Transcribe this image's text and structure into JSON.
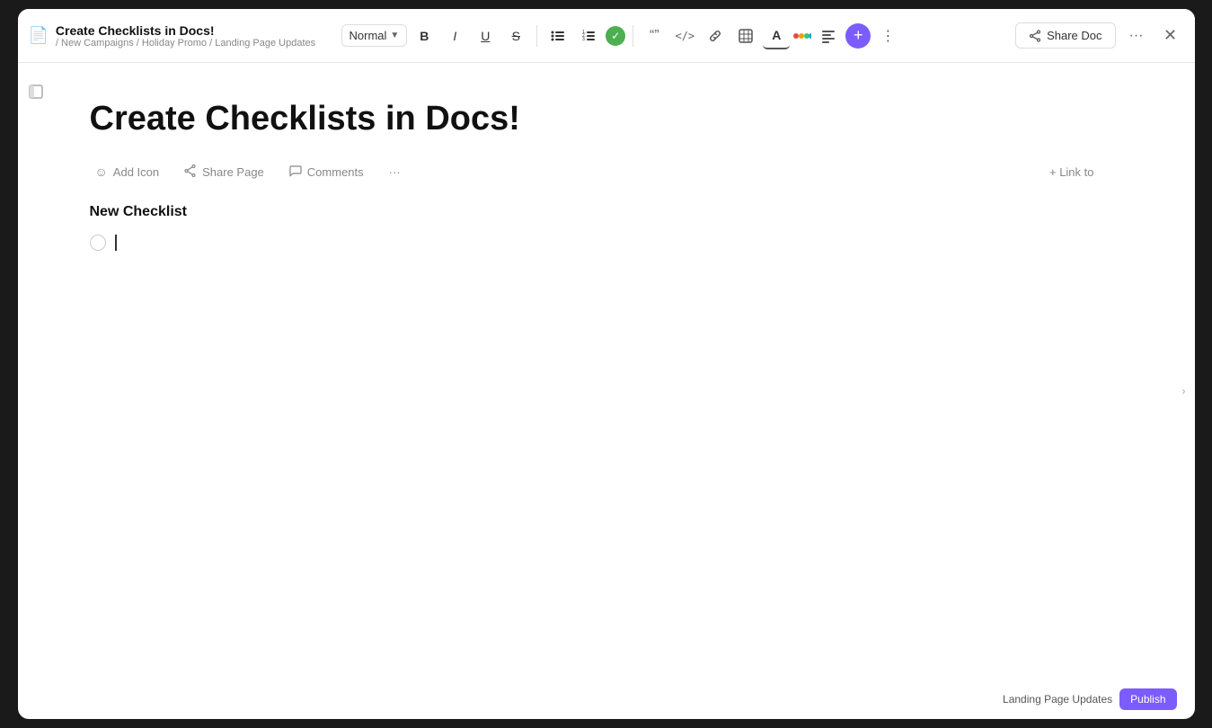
{
  "window": {
    "doc_icon": "📄",
    "title": "Create Checklists in Docs!",
    "breadcrumb": "/ New Campaigns / Holiday Promo / Landing Page Updates"
  },
  "toolbar": {
    "normal_label": "Normal",
    "bold_label": "B",
    "italic_label": "I",
    "underline_label": "U",
    "strikethrough_label": "S",
    "bullet_label": "≡",
    "numbered_label": "≡",
    "quote_label": "❝❞",
    "code_label": "</>",
    "link_label": "🔗",
    "table_label": "⊞",
    "text_color_label": "A",
    "align_label": "≡",
    "share_doc_label": "Share Doc",
    "more_label": "···",
    "close_label": "✕"
  },
  "doc": {
    "heading": "Create Checklists in Docs!",
    "add_icon_label": "Add Icon",
    "share_page_label": "Share Page",
    "comments_label": "Comments",
    "more_actions_label": "···",
    "link_to_label": "+ Link to",
    "section_title": "New Checklist",
    "checklist_placeholder": ""
  },
  "color_dots": [
    {
      "color": "#e74c3c"
    },
    {
      "color": "#f39c12"
    },
    {
      "color": "#2ecc71"
    },
    {
      "color": "#3498db"
    }
  ],
  "bottom_bar": {
    "label": "Landing Page Updates",
    "button_label": "Publish"
  }
}
